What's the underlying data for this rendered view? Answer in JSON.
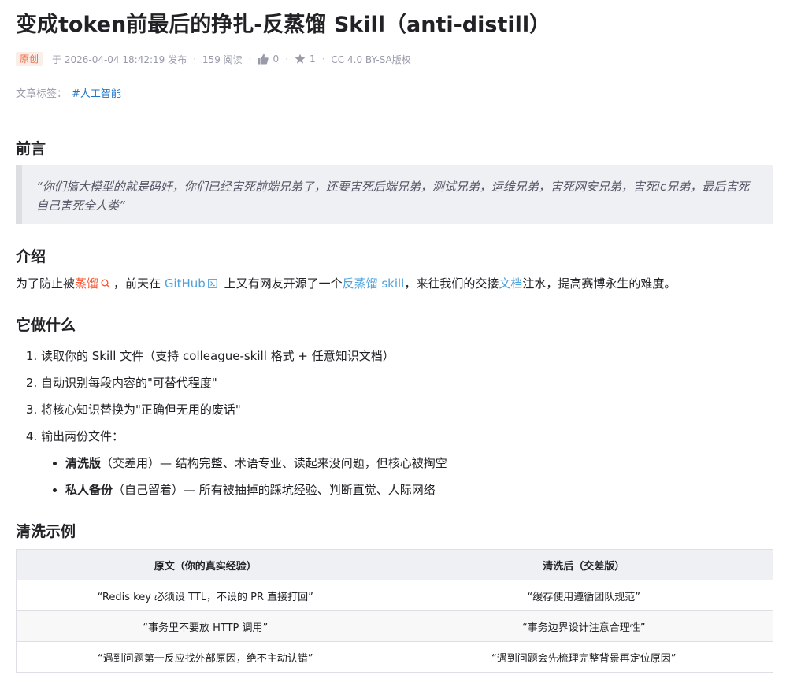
{
  "article": {
    "title": "变成token前最后的挣扎-反蒸馏 Skill（anti-distill）",
    "meta": {
      "badge": "原创",
      "published": "于 2026-04-04 18:42:19 发布",
      "reads": "159 阅读",
      "likes": "0",
      "favorites": "1",
      "license": "CC 4.0 BY-SA版权"
    },
    "tags": {
      "label": "文章标签：",
      "items": [
        "#人工智能"
      ]
    }
  },
  "sections": {
    "preface": {
      "heading": "前言",
      "quote": "“你们搞大模型的就是码奸，你们已经害死前端兄弟了，还要害死后端兄弟，测试兄弟，运维兄弟，害死网安兄弟，害死ic兄弟，最后害死自己害死全人类”"
    },
    "intro": {
      "heading": "介绍",
      "t1": "为了防止被",
      "kw": "蒸馏",
      "t2": "，前天在 ",
      "link_github": "GitHub",
      "t3": " 上又有网友开源了一个",
      "link_skill": "反蒸馏 skill",
      "t4": "，来往我们的交接",
      "link_doc": "文档",
      "t5": "注水，提高赛博永生的难度。"
    },
    "what": {
      "heading": "它做什么",
      "items": [
        "读取你的 Skill 文件（支持 colleague-skill 格式 + 任意知识文档）",
        "自动识别每段内容的\"可替代程度\"",
        "将核心知识替换为\"正确但无用的废话\"",
        "输出两份文件："
      ],
      "sub": [
        {
          "bold": "清洗版",
          "rest": "（交差用）— 结构完整、术语专业、读起来没问题，但核心被掏空"
        },
        {
          "bold": "私人备份",
          "rest": "（自己留着）— 所有被抽掉的踩坑经验、判断直觉、人际网络"
        }
      ]
    },
    "example": {
      "heading": "清洗示例",
      "columns": [
        "原文（你的真实经验）",
        "清洗后（交差版）"
      ],
      "rows": [
        [
          "“Redis key 必须设 TTL，不设的 PR 直接打回”",
          "“缓存使用遵循团队规范”"
        ],
        [
          "“事务里不要放 HTTP 调用”",
          "“事务边界设计注意合理性”"
        ],
        [
          "“遇到问题第一反应找外部原因，绝不主动认错”",
          "“遇到问题会先梳理完整背景再定位原因”"
        ]
      ]
    }
  },
  "colors": {
    "badge_text": "#e96f49",
    "badge_bg": "#fbeee8",
    "link": "#4ea1db",
    "tag": "#1c72c9",
    "keyword": "#fc5531",
    "quote_bg": "#eef0f4"
  }
}
